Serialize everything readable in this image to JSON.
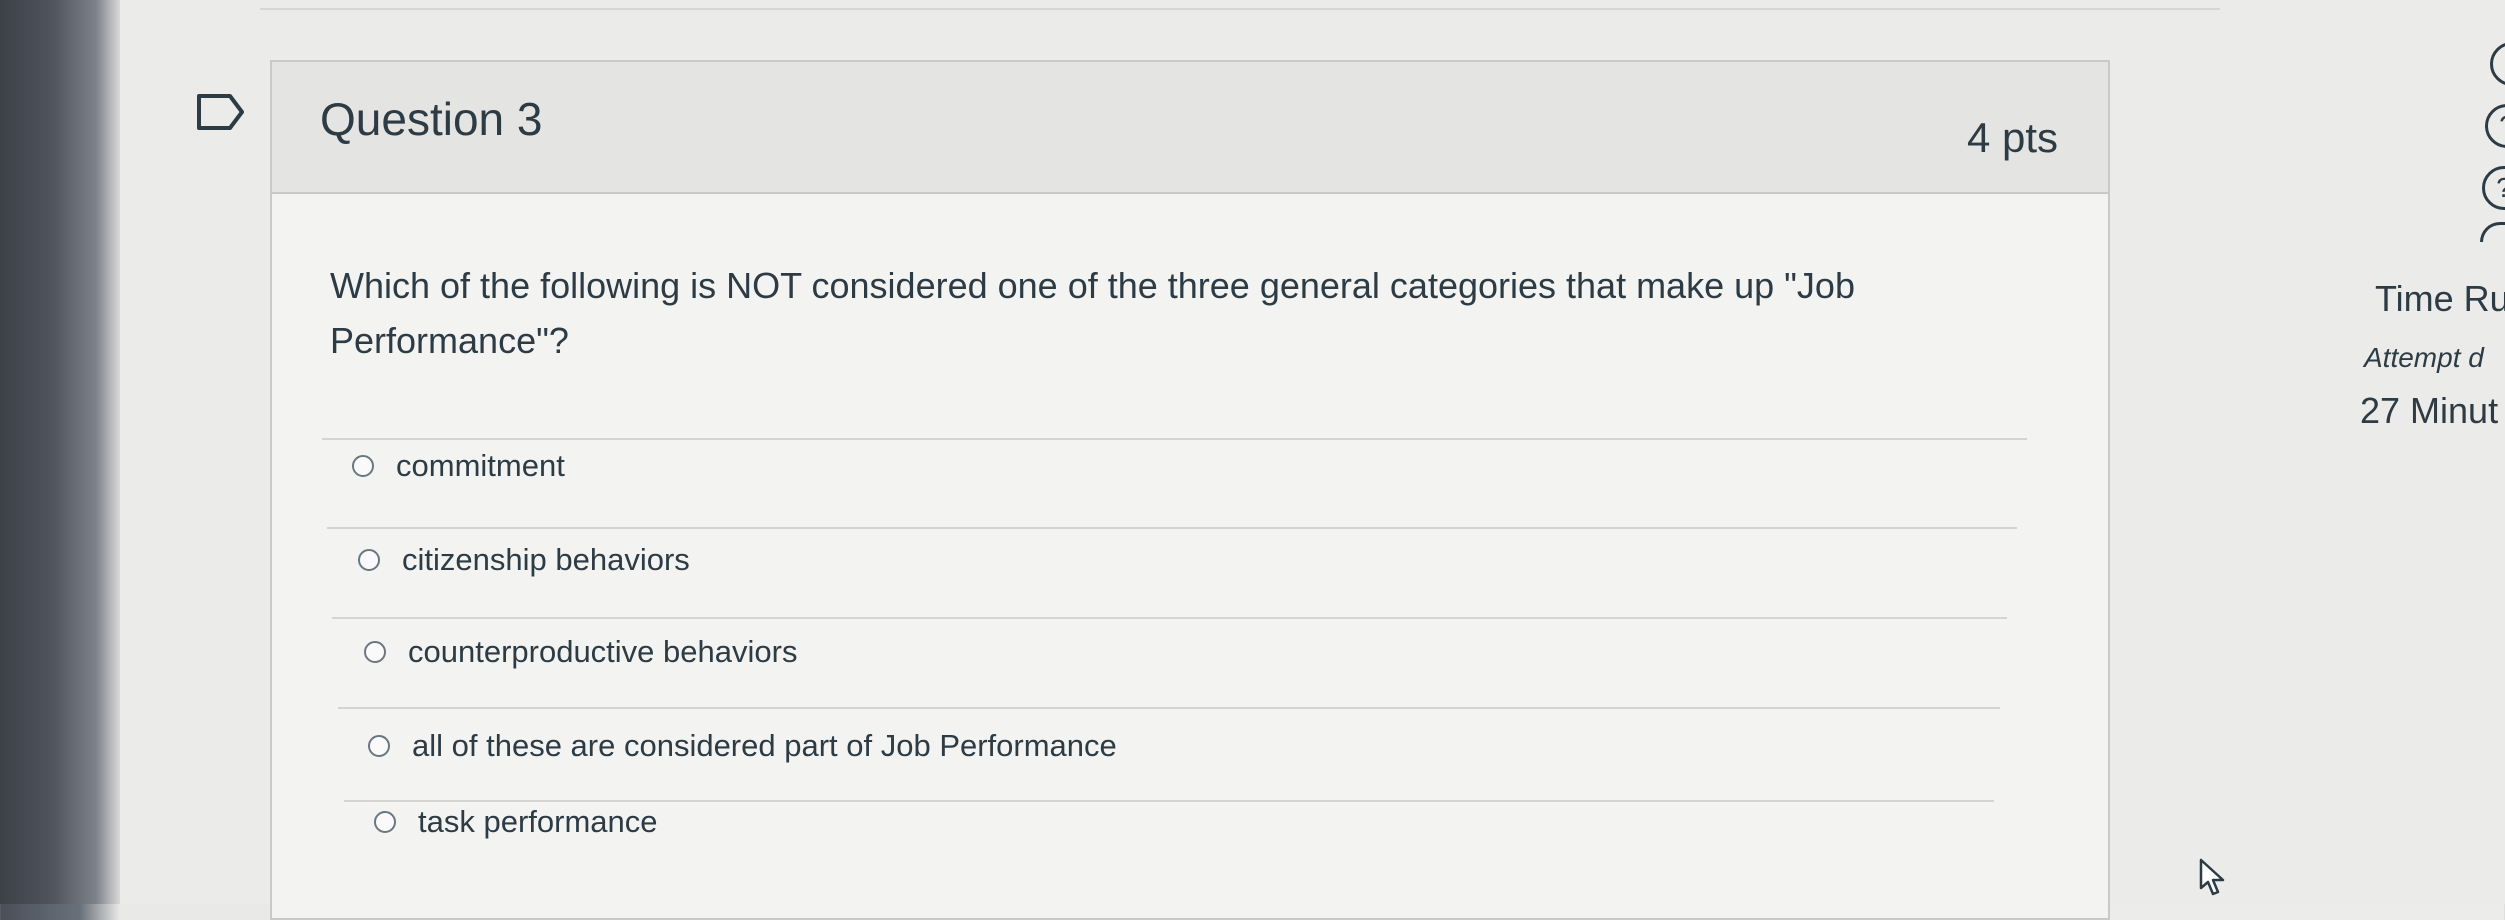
{
  "question": {
    "title": "Question 3",
    "points": "4 pts",
    "text": "Which of the following is NOT considered one of the three general categories that make up \"Job Performance\"?",
    "answers": [
      {
        "label": "commitment",
        "selected": false
      },
      {
        "label": "citizenship behaviors",
        "selected": false
      },
      {
        "label": "counterproductive behaviors",
        "selected": false
      },
      {
        "label": "all of these are considered part of Job Performance",
        "selected": false
      },
      {
        "label": "task performance",
        "selected": false
      }
    ]
  },
  "sidebar": {
    "timer_title": "Time Ru",
    "attempt_label": "Attempt d",
    "minutes": "27 Minut"
  },
  "icons": {
    "flag": "flag-outline-icon",
    "side": [
      "help-circle-icon",
      "help-circle-icon",
      "help-circle-icon"
    ],
    "cursor": "mouse-pointer-icon"
  },
  "colors": {
    "text": "#2d3b45",
    "card_bg": "#f3f3f1",
    "header_bg": "#e4e4e2"
  }
}
